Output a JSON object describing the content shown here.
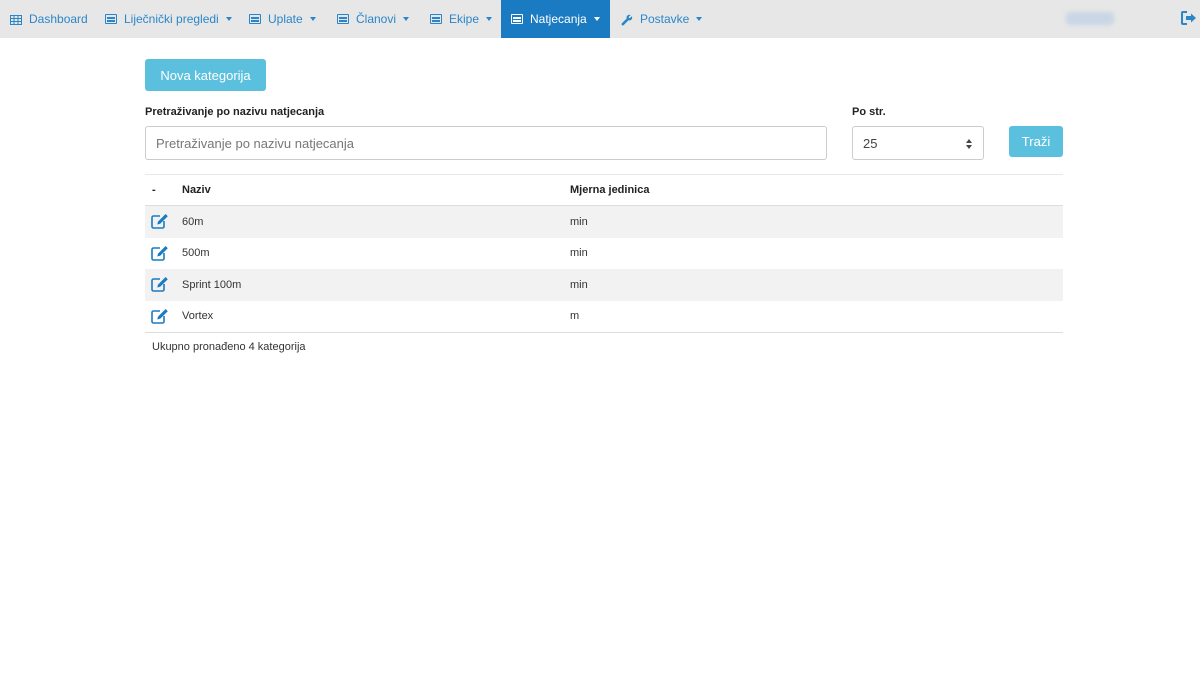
{
  "nav": {
    "items": [
      {
        "label": "Dashboard",
        "icon": "table-icon",
        "has_caret": false,
        "active": false
      },
      {
        "label": "Liječnički pregledi",
        "icon": "list-icon",
        "has_caret": true,
        "active": false
      },
      {
        "label": "Uplate",
        "icon": "list-icon",
        "has_caret": true,
        "active": false
      },
      {
        "label": "Članovi",
        "icon": "list-icon",
        "has_caret": true,
        "active": false
      },
      {
        "label": "Ekipe",
        "icon": "list-icon",
        "has_caret": true,
        "active": false
      },
      {
        "label": "Natjecanja",
        "icon": "list-icon",
        "has_caret": true,
        "active": true
      },
      {
        "label": "Postavke",
        "icon": "wrench-icon",
        "has_caret": true,
        "active": false
      }
    ],
    "logout_icon": "sign-out-icon"
  },
  "actions": {
    "new_category_label": "Nova kategorija"
  },
  "search": {
    "label": "Pretraživanje po nazivu natjecanja",
    "placeholder": "Pretraživanje po nazivu natjecanja"
  },
  "per_page": {
    "label": "Po str.",
    "value": "25"
  },
  "search_button_label": "Traži",
  "table": {
    "headers": [
      "-",
      "Naziv",
      "Mjerna jedinica"
    ],
    "rows": [
      {
        "name": "60m",
        "unit": "min"
      },
      {
        "name": "500m",
        "unit": "min"
      },
      {
        "name": "Sprint 100m",
        "unit": "min"
      },
      {
        "name": "Vortex",
        "unit": "m"
      }
    ]
  },
  "footer": {
    "count_text": "Ukupno pronađeno 4 kategorija"
  },
  "colors": {
    "navbar_bg": "#e7e7e7",
    "nav_link": "#2a86c8",
    "nav_active_bg": "#1a7bc2",
    "button_info": "#5bc0de",
    "row_stripe": "#f2f2f2"
  }
}
